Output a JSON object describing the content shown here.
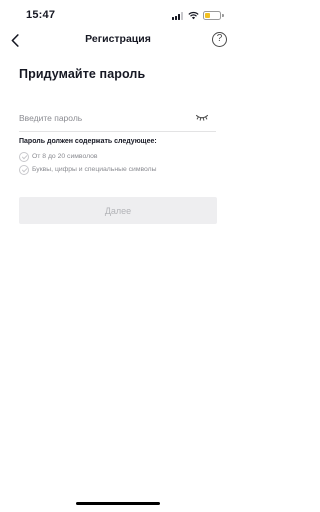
{
  "status_bar": {
    "time": "15:47"
  },
  "nav": {
    "title": "Регистрация",
    "help_label": "?"
  },
  "page": {
    "title": "Придумайте пароль"
  },
  "password": {
    "placeholder": "Введите пароль",
    "value": ""
  },
  "rules": {
    "title": "Пароль должен содержать следующее:",
    "items": [
      {
        "label": "От 8 до 20 символов",
        "satisfied": false
      },
      {
        "label": "Буквы, цифры и специальные символы",
        "satisfied": false
      }
    ]
  },
  "next_button": {
    "label": "Далее",
    "enabled": false
  },
  "colors": {
    "text": "#161823",
    "muted": "#8a8b91",
    "button_disabled_bg": "#eeeef0",
    "battery": "#f1c021"
  }
}
